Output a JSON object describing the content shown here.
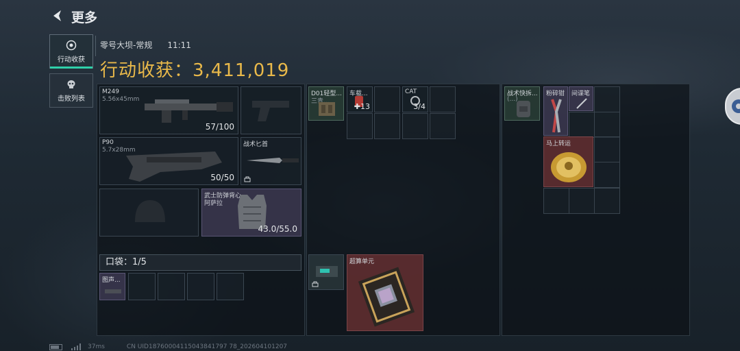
{
  "header": {
    "back_label": "更多"
  },
  "sidebar": {
    "tabs": [
      {
        "label": "行动收获",
        "active": true,
        "icon": "loot-icon"
      },
      {
        "label": "击败列表",
        "active": false,
        "icon": "skull-icon"
      }
    ]
  },
  "match": {
    "map_mode": "零号大坝-常规",
    "time": "11:11",
    "harvest_label": "行动收获：",
    "harvest_value": "3,411,019"
  },
  "loadout": {
    "primary": {
      "name": "M249",
      "caliber": "5.56x45mm",
      "ammo": "57/100"
    },
    "secondary": {
      "name": "P90",
      "caliber": "5.7x28mm",
      "ammo": "50/50"
    },
    "melee": {
      "name": "战术匕首"
    },
    "armor": {
      "name_line1": "武士防弹背心",
      "name_line2": "阿萨拉",
      "durability": "43.0/55.0"
    }
  },
  "pocket": {
    "label": "口袋：",
    "count": "1/5",
    "items": [
      {
        "name": "图声..."
      }
    ]
  },
  "rig_items": [
    {
      "name": "D01轻型...",
      "sub": "三青..."
    },
    {
      "name": "车载...",
      "count": "13"
    },
    {
      "name": "CAT",
      "count": "3/4"
    }
  ],
  "backpack": {
    "name_line1": "战术快拆...",
    "name_line2": "(...)"
  },
  "container_items": [
    {
      "name": "粉碎钳"
    },
    {
      "name": "间谍笔"
    },
    {
      "name": "马上转运"
    }
  ],
  "bottom_items": [
    {
      "name": "超算单元"
    }
  ],
  "footer": {
    "ping": "37ms",
    "uid": "CN UID18760004115043841797 78_202604101207"
  },
  "colors": {
    "accent_gold": "#e9b94a",
    "tab_active_green": "#2fd0a9",
    "rare_red": "#5f2d30",
    "purple": "#3c3850"
  }
}
